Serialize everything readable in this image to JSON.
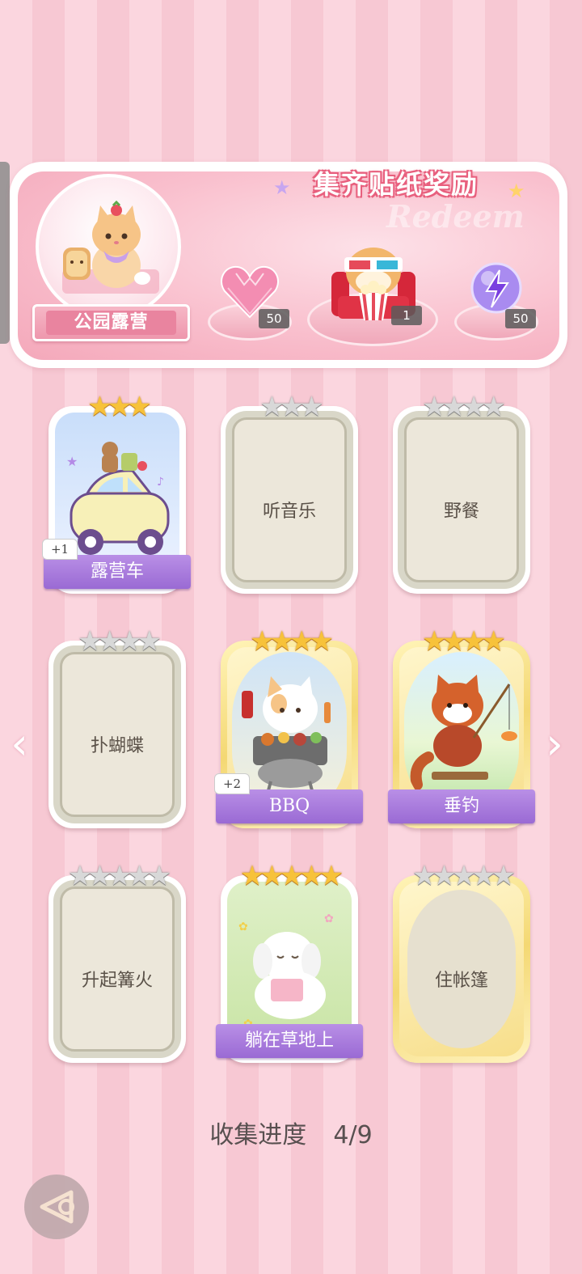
{
  "banner": {
    "title": "集齐贴纸奖励",
    "watermark": "Redeem",
    "theme_name": "公园露营",
    "rewards": [
      {
        "icon": "pink-heart-gem-icon",
        "count": "50"
      },
      {
        "icon": "cinema-cat-icon",
        "count": "1"
      },
      {
        "icon": "lightning-orb-icon",
        "count": "50"
      }
    ]
  },
  "cards": [
    {
      "name": "露营车",
      "stars": 3,
      "max_stars": 3,
      "unlocked": true,
      "dup": "+1",
      "gold": false,
      "art": "camper-car-art"
    },
    {
      "name": "听音乐",
      "stars": 0,
      "max_stars": 3,
      "unlocked": false,
      "gold": false
    },
    {
      "name": "野餐",
      "stars": 0,
      "max_stars": 4,
      "unlocked": false,
      "gold": false
    },
    {
      "name": "扑蝴蝶",
      "stars": 0,
      "max_stars": 4,
      "unlocked": false,
      "gold": false
    },
    {
      "name": "BBQ",
      "stars": 4,
      "max_stars": 4,
      "unlocked": true,
      "dup": "+2",
      "gold": true,
      "art": "bbq-cat-art"
    },
    {
      "name": "垂钓",
      "stars": 4,
      "max_stars": 4,
      "unlocked": true,
      "dup": "",
      "gold": true,
      "art": "red-panda-fishing-art"
    },
    {
      "name": "升起篝火",
      "stars": 0,
      "max_stars": 5,
      "unlocked": false,
      "gold": false
    },
    {
      "name": "躺在草地上",
      "stars": 5,
      "max_stars": 5,
      "unlocked": true,
      "dup": "",
      "gold": false,
      "art": "puppy-reading-art"
    },
    {
      "name": "住帐篷",
      "stars": 0,
      "max_stars": 5,
      "unlocked": false,
      "gold": true
    }
  ],
  "progress_label": "收集进度",
  "progress_value": "4/9",
  "colors": {
    "accent_pink": "#e8607e",
    "ribbon_purple": "#9a6ad4",
    "star_gold": "#f7c23a"
  }
}
